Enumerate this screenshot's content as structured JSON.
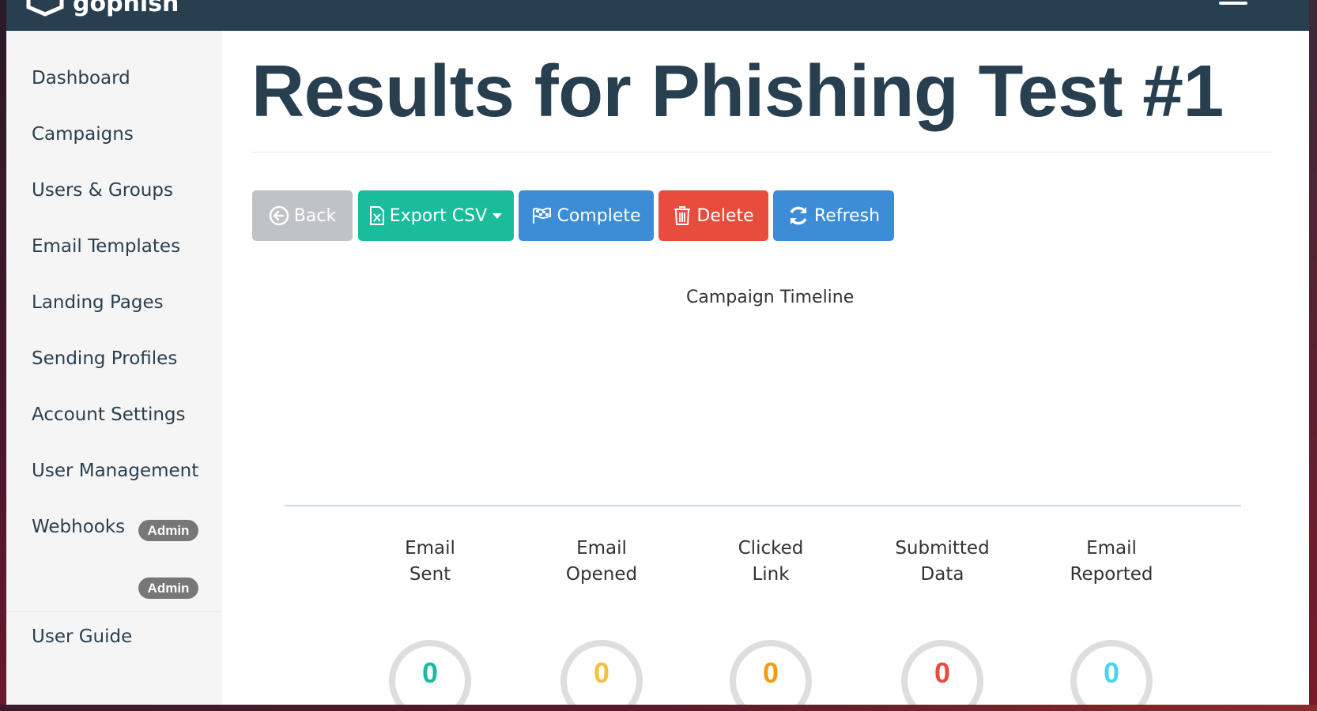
{
  "navbar": {
    "brand": "gophish",
    "logo_icon": "gophish-logo-icon",
    "menu_icon": "hamburger-icon"
  },
  "sidebar": {
    "items": [
      {
        "label": "Dashboard"
      },
      {
        "label": "Campaigns"
      },
      {
        "label": "Users & Groups"
      },
      {
        "label": "Email Templates"
      },
      {
        "label": "Landing Pages"
      },
      {
        "label": "Sending Profiles"
      },
      {
        "label": "Account Settings"
      },
      {
        "label": "User Management",
        "badge": "Admin"
      },
      {
        "label": "Webhooks",
        "badge": "Admin"
      }
    ],
    "footer_item": "User Guide"
  },
  "page": {
    "title": "Results for Phishing Test #1"
  },
  "toolbar": {
    "back": "Back",
    "export": "Export CSV",
    "complete": "Complete",
    "delete": "Delete",
    "refresh": "Refresh"
  },
  "timeline": {
    "title": "Campaign Timeline"
  },
  "stats": [
    {
      "line1": "Email",
      "line2": "Sent",
      "value": "0",
      "color": "#1abc9c"
    },
    {
      "line1": "Email",
      "line2": "Opened",
      "value": "0",
      "color": "#f9bf3b"
    },
    {
      "line1": "Clicked",
      "line2": "Link",
      "value": "0",
      "color": "#f39c12"
    },
    {
      "line1": "Submitted",
      "line2": "Data",
      "value": "0",
      "color": "#e74c3c"
    },
    {
      "line1": "Email",
      "line2": "Reported",
      "value": "0",
      "color": "#45d6ef"
    }
  ],
  "colors": {
    "navbar": "#283f50",
    "sidebar": "#f5f5f5",
    "back": "#bdc3c7",
    "export": "#1abc9c",
    "complete": "#3c8dd6",
    "delete": "#e74c3c",
    "refresh": "#3c8dd6",
    "badge": "#777777"
  }
}
